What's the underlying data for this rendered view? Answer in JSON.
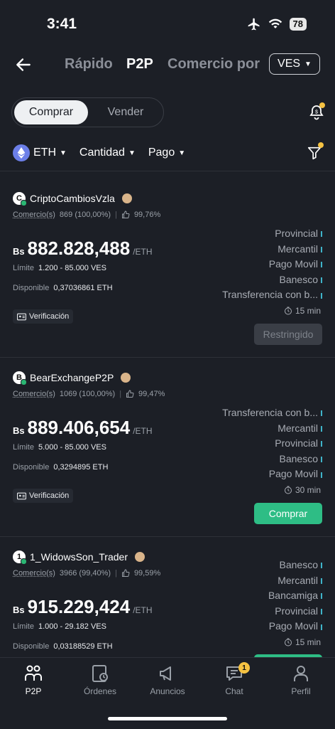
{
  "status_bar": {
    "time": "3:41",
    "battery": "78"
  },
  "header": {
    "tabs": [
      {
        "label": "Rápido",
        "active": false
      },
      {
        "label": "P2P",
        "active": true
      },
      {
        "label": "Comercio por",
        "active": false
      }
    ],
    "currency": "VES"
  },
  "segment": {
    "buy_label": "Comprar",
    "sell_label": "Vender",
    "selected": "Comprar"
  },
  "filters": {
    "asset": "ETH",
    "amount_label": "Cantidad",
    "payment_label": "Pago"
  },
  "offers": [
    {
      "avatar_letter": "C",
      "merchant": "CriptoCambiosVzla",
      "trades_label": "Comercio(s)",
      "trades": "869 (100,00%)",
      "rating": "99,76%",
      "currency_symbol": "Bs",
      "price": "882.828,488",
      "unit": "/ETH",
      "limit_label": "Límite",
      "limit": "1.200 - 85.000 VES",
      "available_label": "Disponible",
      "available": "0,37036861 ETH",
      "verification": "Verificación",
      "payments": [
        "Provincial",
        "Mercantil",
        "Pago Movil",
        "Banesco",
        "Transferencia con b..."
      ],
      "time_limit": "15 min",
      "action": "Restringido",
      "action_enabled": false
    },
    {
      "avatar_letter": "B",
      "merchant": "BearExchangeP2P",
      "trades_label": "Comercio(s)",
      "trades": "1069 (100,00%)",
      "rating": "99,47%",
      "currency_symbol": "Bs",
      "price": "889.406,654",
      "unit": "/ETH",
      "limit_label": "Límite",
      "limit": "5.000 - 85.000 VES",
      "available_label": "Disponible",
      "available": "0,3294895 ETH",
      "verification": "Verificación",
      "payments": [
        "Transferencia con b...",
        "Mercantil",
        "Provincial",
        "Banesco",
        "Pago Movil"
      ],
      "time_limit": "30 min",
      "action": "Comprar",
      "action_enabled": true
    },
    {
      "avatar_letter": "1",
      "merchant": "1_WidowsSon_Trader",
      "trades_label": "Comercio(s)",
      "trades": "3966 (99,40%)",
      "rating": "99,59%",
      "currency_symbol": "Bs",
      "price": "915.229,424",
      "unit": "/ETH",
      "limit_label": "Límite",
      "limit": "1.000 - 29.182 VES",
      "available_label": "Disponible",
      "available": "0,03188529 ETH",
      "payments": [
        "Banesco",
        "Mercantil",
        "Bancamiga",
        "Provincial",
        "Pago Movil"
      ],
      "time_limit": "15 min"
    }
  ],
  "bottom_nav": [
    {
      "label": "P2P",
      "icon": "p2p-icon",
      "active": true
    },
    {
      "label": "Órdenes",
      "icon": "orders-icon",
      "active": false
    },
    {
      "label": "Anuncios",
      "icon": "megaphone-icon",
      "active": false
    },
    {
      "label": "Chat",
      "icon": "chat-icon",
      "active": false,
      "badge": "1"
    },
    {
      "label": "Perfil",
      "icon": "profile-icon",
      "active": false
    }
  ],
  "colors": {
    "background": "#1c1f26",
    "accent_green": "#2ebd85",
    "badge_yellow": "#f5c242"
  }
}
